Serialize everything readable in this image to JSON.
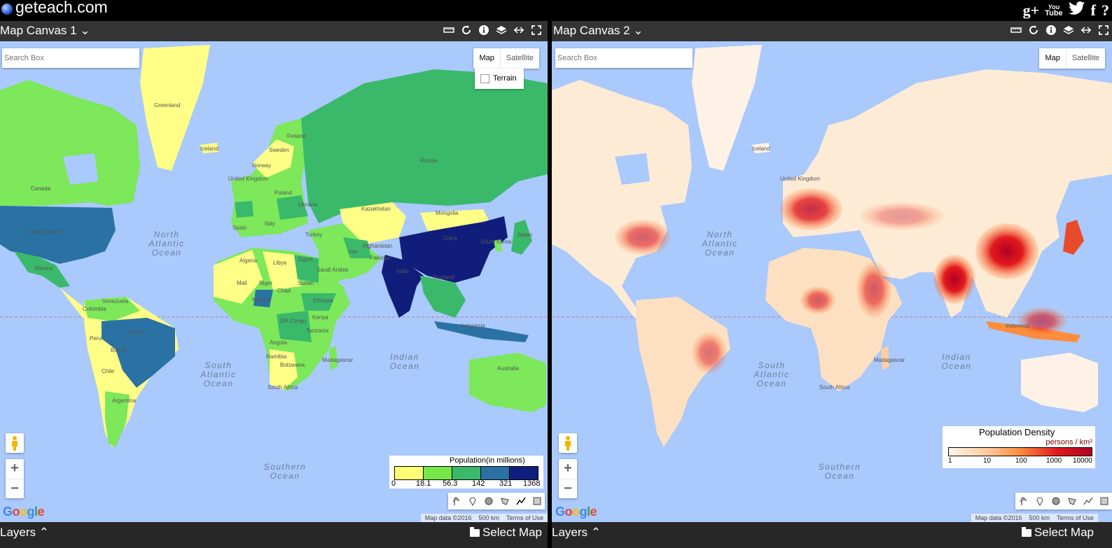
{
  "site": {
    "logo_text": "geteach.com"
  },
  "social": {
    "gplus": "g+",
    "youtube_top": "You",
    "youtube_bottom": "Tube",
    "twitter": "🐦",
    "facebook": "f",
    "help": "?"
  },
  "canvas1": {
    "title": "Map Canvas 1 ⌄",
    "search_placeholder": "Search Box",
    "map_button": "Map",
    "satellite_button": "Satellite",
    "terrain_label": "Terrain",
    "legend": {
      "title": "Population(in millions)",
      "colors": [
        "#ffff75",
        "#76e648",
        "#3ab96b",
        "#2b72a4",
        "#0f1e7d"
      ],
      "ticks": [
        "0",
        "18.1",
        "56.3",
        "142",
        "321",
        "1368"
      ]
    },
    "attribution": {
      "map_data": "Map data ©2016",
      "scale": "500 km",
      "terms": "Terms of Use"
    },
    "google": "Google",
    "layers_label": "Layers ⌃",
    "select_map_label": "Select Map"
  },
  "canvas2": {
    "title": "Map Canvas 2 ⌄",
    "search_placeholder": "Search Box",
    "map_button": "Map",
    "satellite_button": "Satellite",
    "legend": {
      "title": "Population Density",
      "unit": "persons / km²",
      "ticks": [
        "1",
        "10",
        "100",
        "1000",
        "10000"
      ]
    },
    "attribution": {
      "map_data": "Map data ©2016",
      "scale": "500 km",
      "terms": "Terms of Use"
    },
    "google": "Google",
    "layers_label": "Layers ⌃",
    "select_map_label": "Select Map"
  },
  "map_labels": {
    "north_atlantic": "North Atlantic Ocean",
    "south_atlantic": "South Atlantic Ocean",
    "indian": "Indian Ocean",
    "southern": "Southern Ocean",
    "countries1": [
      "Greenland",
      "Canada",
      "United States",
      "Mexico",
      "Colombia",
      "Brazil",
      "Peru",
      "Bolivia",
      "Argentina",
      "Chile",
      "Venezuela",
      "Finland",
      "Sweden",
      "Norway",
      "Russia",
      "Kazakhstan",
      "Mongolia",
      "China",
      "India",
      "Iran",
      "Turkey",
      "Ukraine",
      "Poland",
      "Spain",
      "Italy",
      "Algeria",
      "Libya",
      "Egypt",
      "Saudi Arabia",
      "Mali",
      "Niger",
      "Chad",
      "Sudan",
      "Ethiopia",
      "Nigeria",
      "DR Congo",
      "Kenya",
      "Tanzania",
      "Angola",
      "Namibia",
      "Botswana",
      "South Africa",
      "Madagascar",
      "Indonesia",
      "Thailand",
      "Japan",
      "South Korea",
      "Australia",
      "Afghanistan",
      "Pakistan",
      "Iceland",
      "United Kingdom"
    ],
    "countries2": [
      "Iceland",
      "United Kingdom",
      "Indonesia",
      "Madagascar",
      "South Africa"
    ]
  }
}
